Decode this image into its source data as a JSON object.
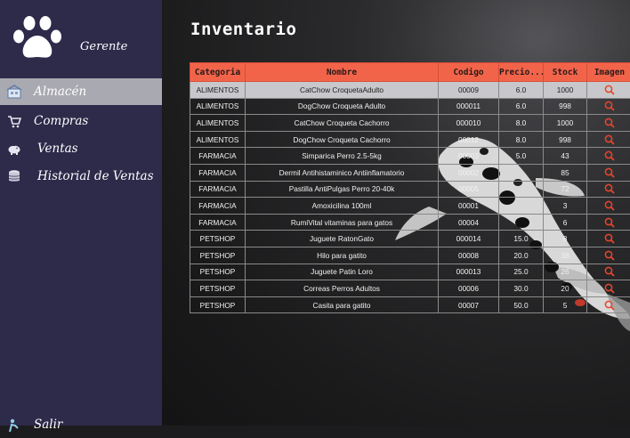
{
  "sidebar": {
    "role": "Gerente",
    "items": [
      {
        "label": "Almacén",
        "icon": "warehouse-icon",
        "active": true
      },
      {
        "label": "Compras",
        "icon": "cart-icon",
        "active": false
      },
      {
        "label": "Ventas",
        "icon": "piggy-bank-icon",
        "active": false
      },
      {
        "label": "Historial de Ventas",
        "icon": "database-icon",
        "active": false
      }
    ],
    "logout": {
      "label": "Salir",
      "icon": "logout-icon"
    }
  },
  "main": {
    "title": "Inventario",
    "table": {
      "headers": [
        "Categoria",
        "Nombre",
        "Codigo",
        "Precio...",
        "Stock",
        "Imagen"
      ],
      "rows": [
        [
          "ALIMENTOS",
          "CatChow CroquetaAdulto",
          "00009",
          "6.0",
          "1000"
        ],
        [
          "ALIMENTOS",
          "DogChow Croqueta Adulto",
          "000011",
          "6.0",
          "998"
        ],
        [
          "ALIMENTOS",
          "CatChow Croqueta Cachorro",
          "000010",
          "8.0",
          "1000"
        ],
        [
          "ALIMENTOS",
          "DogChow Croqueta Cachorro",
          "00012",
          "8.0",
          "998"
        ],
        [
          "FARMACIA",
          "Simparica Perro 2.5-5kg",
          "00003",
          "5.0",
          "43"
        ],
        [
          "FARMACIA",
          "Dermil Antihistaminico Antiinflamatorio",
          "00002",
          "",
          "85"
        ],
        [
          "FARMACIA",
          "Pastilla AntiPulgas Perro 20-40k",
          "00005",
          "",
          "72"
        ],
        [
          "FARMACIA",
          "Amoxicilina 100ml",
          "00001",
          "",
          "3"
        ],
        [
          "FARMACIA",
          "RumiVital vitaminas para gatos",
          "00004",
          "",
          "6"
        ],
        [
          "PETSHOP",
          "Juguete RatonGato",
          "000014",
          "15.0",
          "8"
        ],
        [
          "PETSHOP",
          "Hilo para gatito",
          "00008",
          "20.0",
          "38"
        ],
        [
          "PETSHOP",
          "Juguete Patin Loro",
          "000013",
          "25.0",
          "26"
        ],
        [
          "PETSHOP",
          "Correas Perros Adultos",
          "00006",
          "30.0",
          "20"
        ],
        [
          "PETSHOP",
          "Casita para gatito",
          "00007",
          "50.0",
          "5"
        ]
      ],
      "selected_row": 0,
      "image_icon": "magnifier-icon"
    }
  },
  "colors": {
    "sidebar": "#2d2a4a",
    "active_item": "#a9a9b1",
    "header": "#f2644a",
    "icon": "#e8452c"
  }
}
